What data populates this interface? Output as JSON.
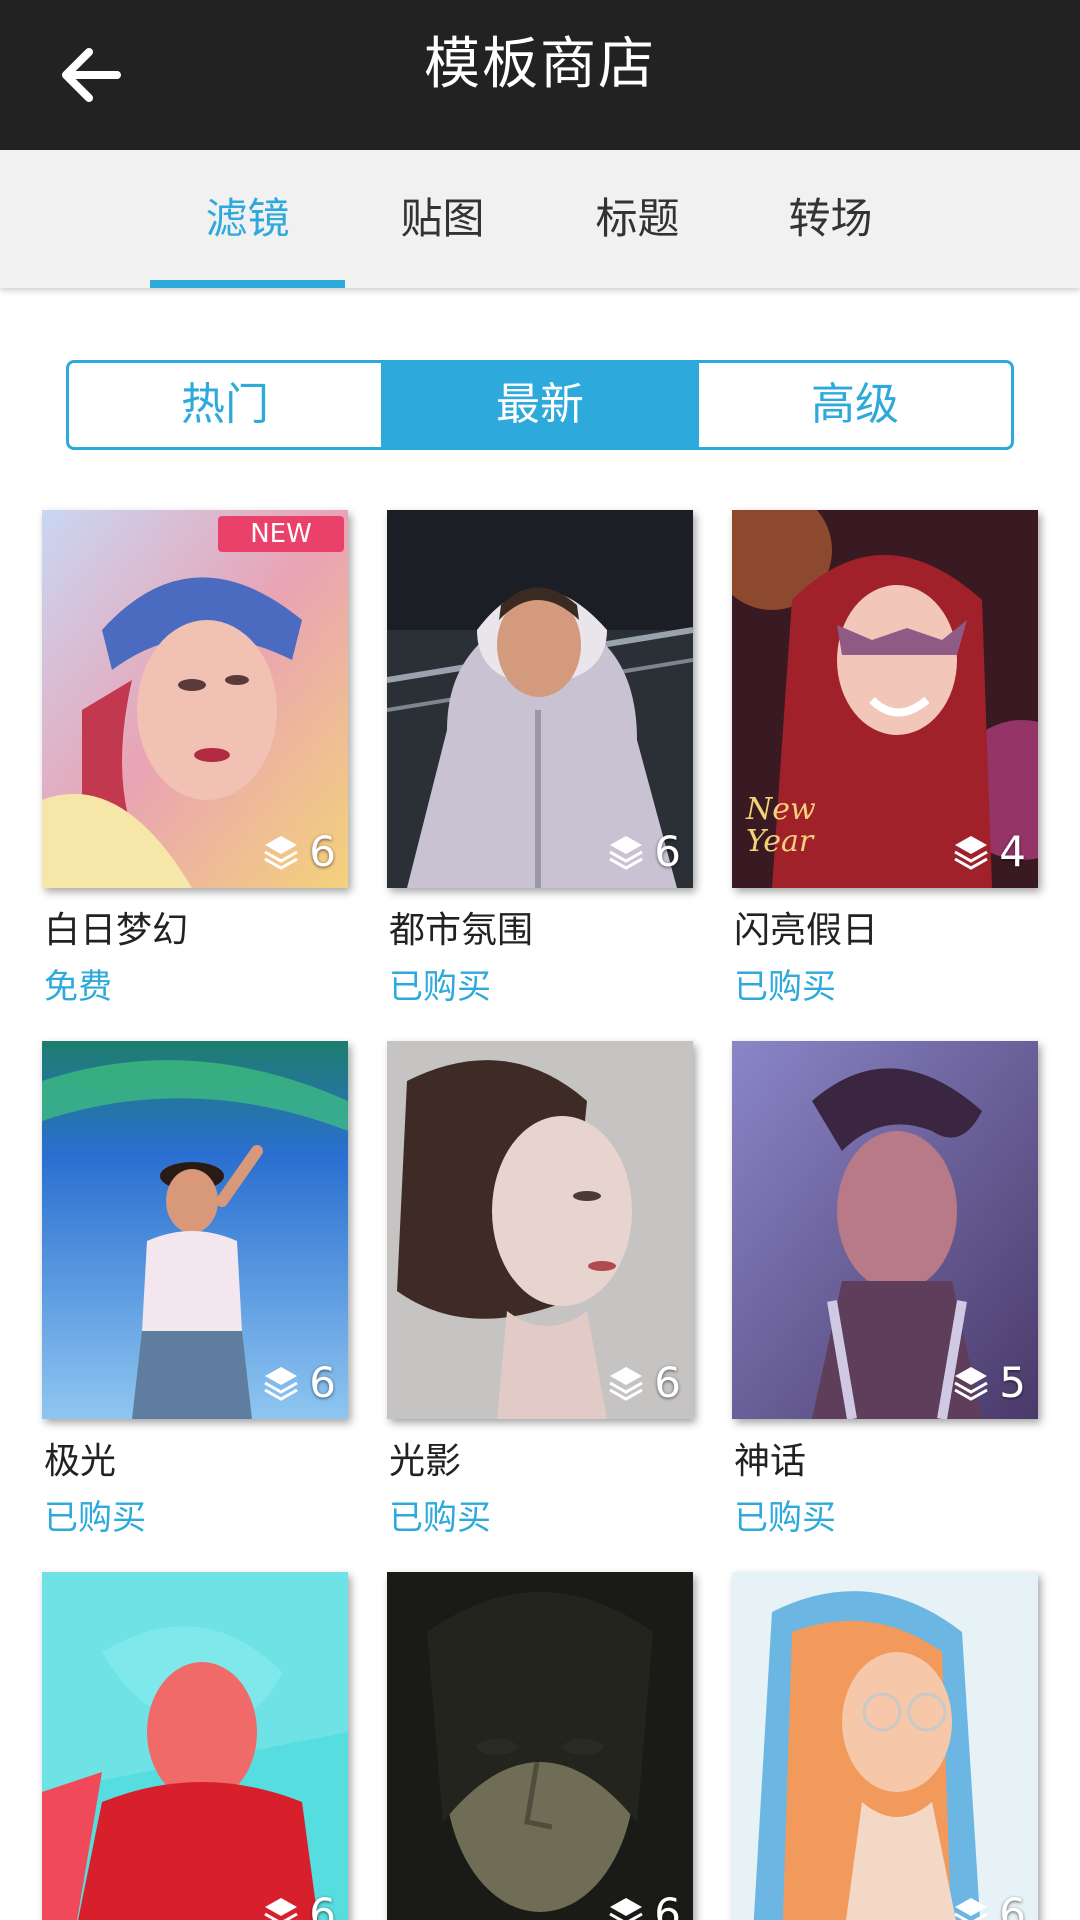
{
  "header": {
    "title": "模板商店"
  },
  "category_tabs": [
    {
      "label": "滤镜",
      "active": true
    },
    {
      "label": "贴图",
      "active": false
    },
    {
      "label": "标题",
      "active": false
    },
    {
      "label": "转场",
      "active": false
    }
  ],
  "segment": [
    {
      "label": "热门",
      "active": false
    },
    {
      "label": "最新",
      "active": true
    },
    {
      "label": "高级",
      "active": false
    }
  ],
  "accent_color": "#2da9dc",
  "templates": [
    {
      "name": "白日梦幻",
      "price": "免费",
      "count": "6",
      "badge": "NEW"
    },
    {
      "name": "都市氛围",
      "price": "已购买",
      "count": "6"
    },
    {
      "name": "闪亮假日",
      "price": "已购买",
      "count": "4",
      "thumb_text": "New Year"
    },
    {
      "name": "极光",
      "price": "已购买",
      "count": "6"
    },
    {
      "name": "光影",
      "price": "已购买",
      "count": "6"
    },
    {
      "name": "神话",
      "price": "已购买",
      "count": "5"
    },
    {
      "count": "6"
    },
    {
      "count": "6"
    },
    {
      "count": "6"
    }
  ],
  "icons": {
    "back": "arrow-left-icon",
    "layers": "layers-icon"
  }
}
